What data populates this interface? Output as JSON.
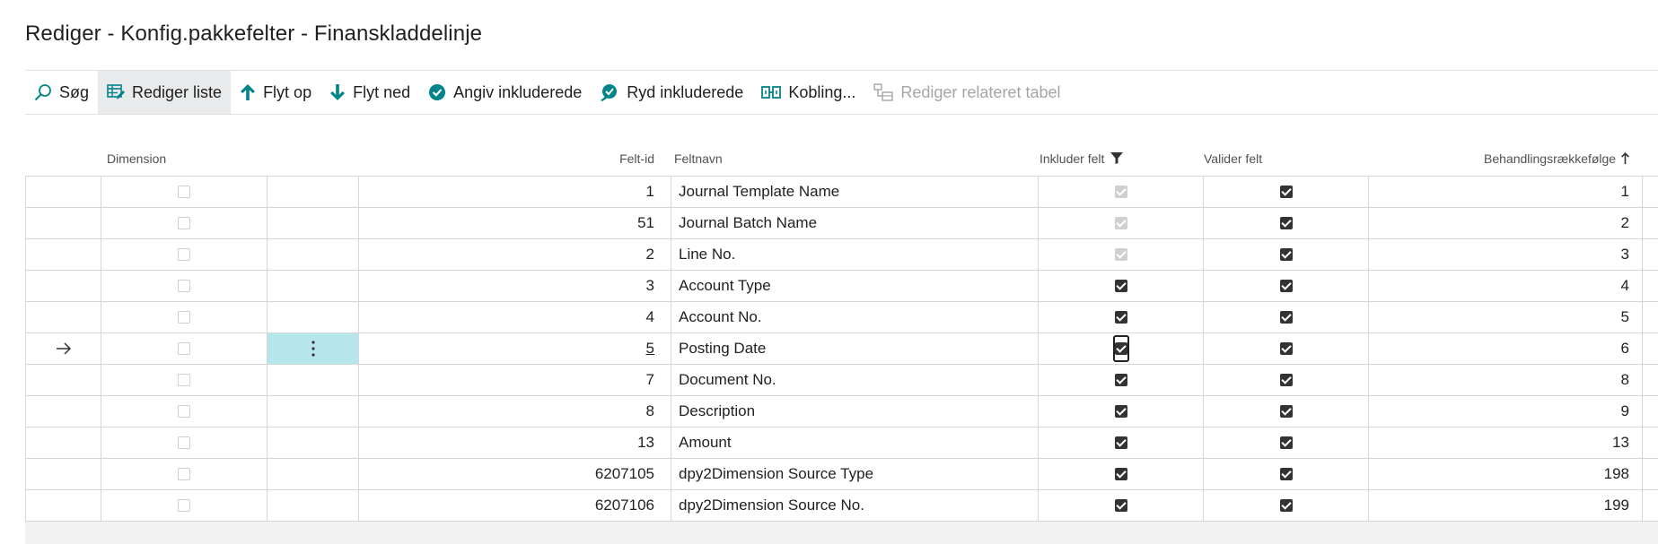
{
  "page": {
    "title": "Rediger - Konfig.pakkefelter - Finanskladdelinje"
  },
  "toolbar": {
    "search": "Søg",
    "edit_list": "Rediger liste",
    "move_up": "Flyt op",
    "move_down": "Flyt ned",
    "set_included": "Angiv inkluderede",
    "clear_included": "Ryd inkluderede",
    "relation": "Kobling...",
    "edit_related_table": "Rediger relateret tabel"
  },
  "columns": {
    "dimension": "Dimension",
    "field_id": "Felt-id",
    "field_name": "Feltnavn",
    "include_field": "Inkluder felt",
    "validate_field": "Valider felt",
    "processing_order": "Behandlingsrækkefølge"
  },
  "rows": [
    {
      "id": "1",
      "name": "Journal Template Name",
      "include": "dim",
      "validate": "on",
      "order": "1"
    },
    {
      "id": "51",
      "name": "Journal Batch Name",
      "include": "dim",
      "validate": "on",
      "order": "2"
    },
    {
      "id": "2",
      "name": "Line No.",
      "include": "dim",
      "validate": "on",
      "order": "3"
    },
    {
      "id": "3",
      "name": "Account Type",
      "include": "on",
      "validate": "on",
      "order": "4"
    },
    {
      "id": "4",
      "name": "Account No.",
      "include": "on",
      "validate": "on",
      "order": "5"
    },
    {
      "id": "5",
      "name": "Posting Date",
      "include": "on",
      "validate": "on",
      "order": "6",
      "selected": true
    },
    {
      "id": "7",
      "name": "Document No.",
      "include": "on",
      "validate": "on",
      "order": "8"
    },
    {
      "id": "8",
      "name": "Description",
      "include": "on",
      "validate": "on",
      "order": "9"
    },
    {
      "id": "13",
      "name": "Amount",
      "include": "on",
      "validate": "on",
      "order": "13"
    },
    {
      "id": "6207105",
      "name": "dpy2Dimension Source Type",
      "include": "on",
      "validate": "on",
      "order": "198"
    },
    {
      "id": "6207106",
      "name": "dpy2Dimension Source No.",
      "include": "on",
      "validate": "on",
      "order": "199"
    }
  ],
  "colors": {
    "accent": "#008489",
    "selected_cell": "#b4e6eb"
  }
}
